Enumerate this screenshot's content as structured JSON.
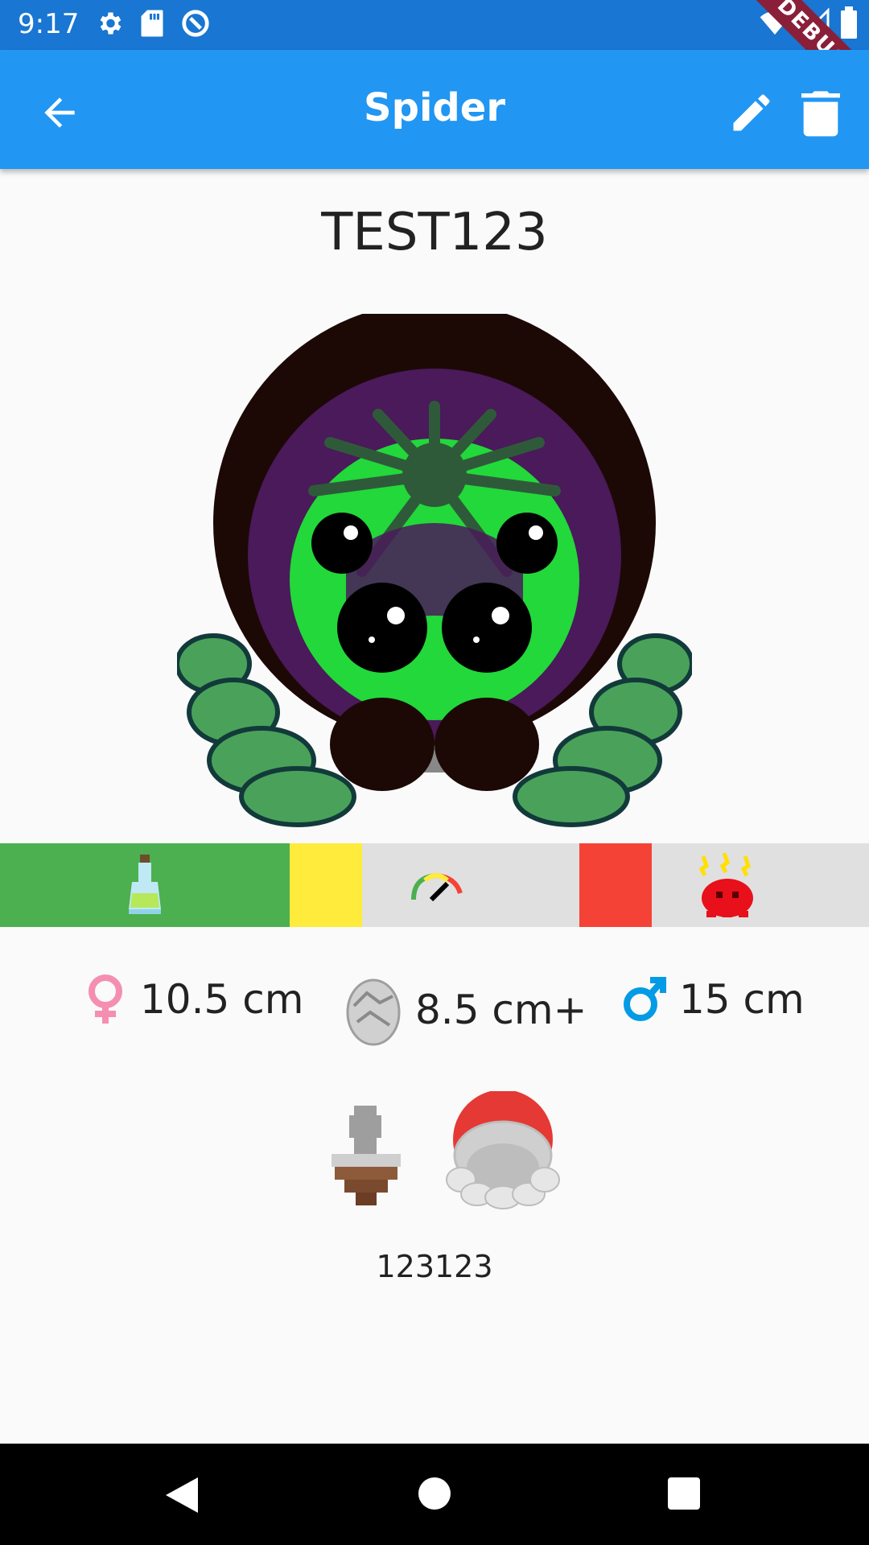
{
  "status_bar": {
    "time": "9:17",
    "debug_label": "DEBUG",
    "icons": [
      "settings-icon",
      "sd-card-icon",
      "sync-icon",
      "wifi-icon",
      "signal-icon",
      "battery-icon"
    ]
  },
  "app_bar": {
    "title": "Spider",
    "actions": [
      "back-arrow-icon",
      "edit-pencil-icon",
      "delete-trash-icon"
    ]
  },
  "spider": {
    "name": "TEST123",
    "code": "123123"
  },
  "status_strip": {
    "segments": [
      {
        "icon": "potion-bottle-icon",
        "color": "#4caf50"
      },
      {
        "icon": "none",
        "color": "#ffeb3b"
      },
      {
        "icon": "rainbow-gauge-icon",
        "color": "#e0e0e0"
      },
      {
        "icon": "none",
        "color": "#f44336"
      },
      {
        "icon": "angry-red-blob-icon",
        "color": "#e0e0e0"
      }
    ]
  },
  "sizes": {
    "female": "10.5 cm",
    "egg": "8.5 cm+",
    "male": "15 cm"
  },
  "colors": {
    "status_bar": "#1976d2",
    "app_bar": "#2196f3",
    "female": "#f48fb1",
    "male": "#039be5"
  }
}
